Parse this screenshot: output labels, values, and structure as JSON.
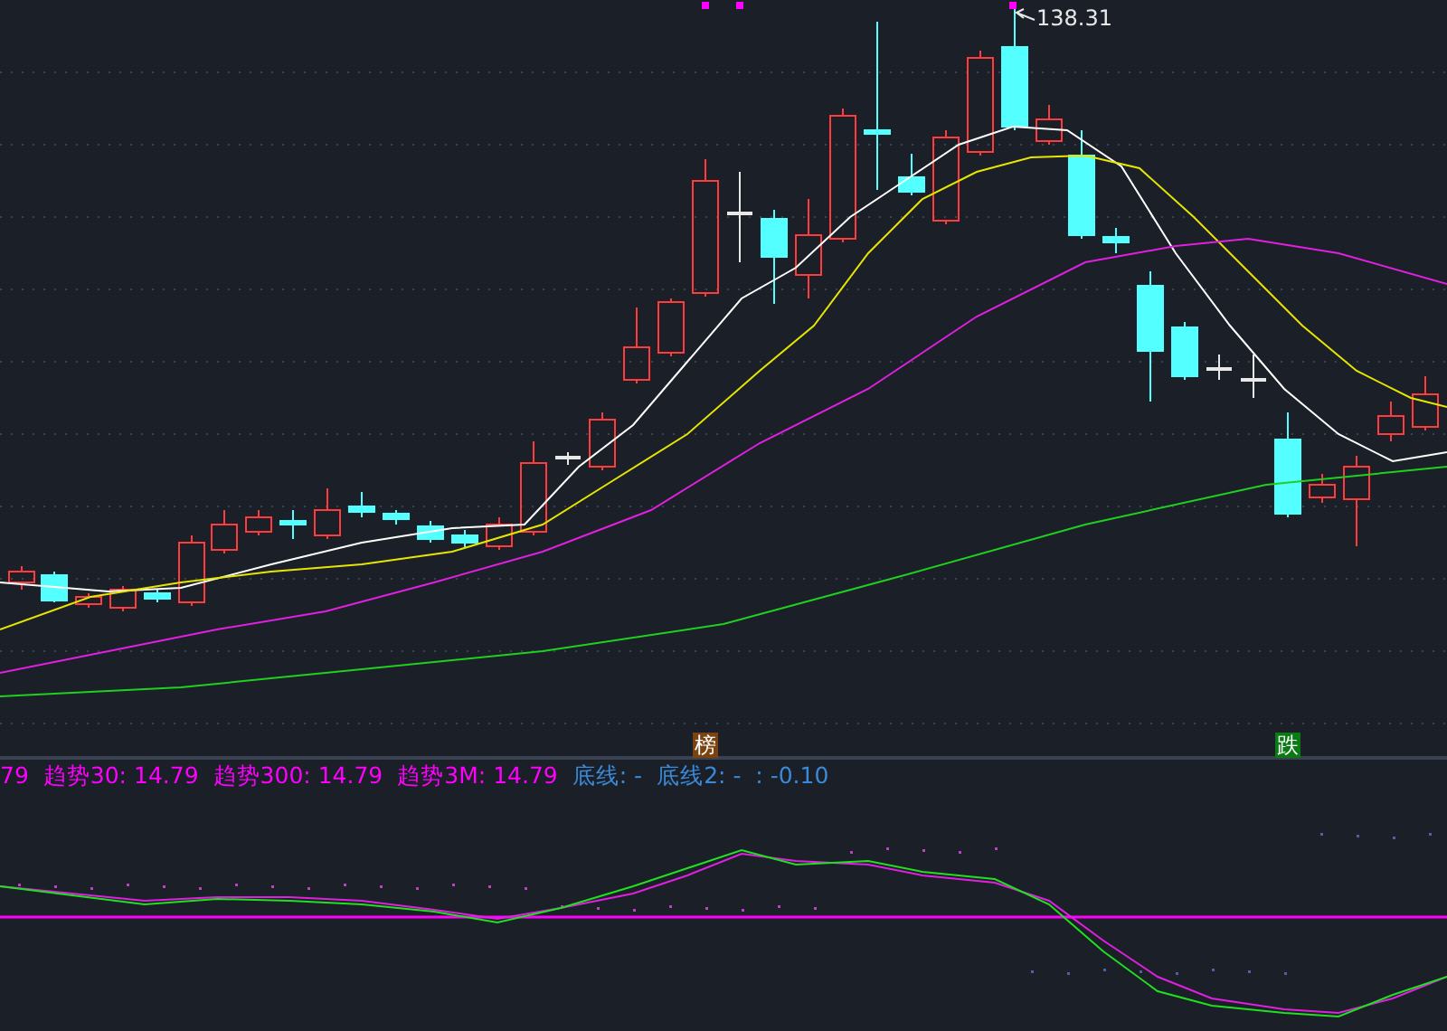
{
  "price_high_label": "138.31",
  "markers": [
    {
      "label": "榜",
      "color": "#7a4410"
    },
    {
      "label": "跌",
      "color": "#0a7a14"
    }
  ],
  "legend": [
    {
      "text": "79",
      "color": "#ff00ff"
    },
    {
      "text": "趋势30: 14.79",
      "color": "#ff00ff"
    },
    {
      "text": "趋势300: 14.79",
      "color": "#ff00ff"
    },
    {
      "text": "趋势3M: 14.79",
      "color": "#ff00ff"
    },
    {
      "text": "底线: -",
      "color": "#3a8ad8"
    },
    {
      "text": "底线2: -  : -0.10",
      "color": "#3a8ad8"
    }
  ]
}
